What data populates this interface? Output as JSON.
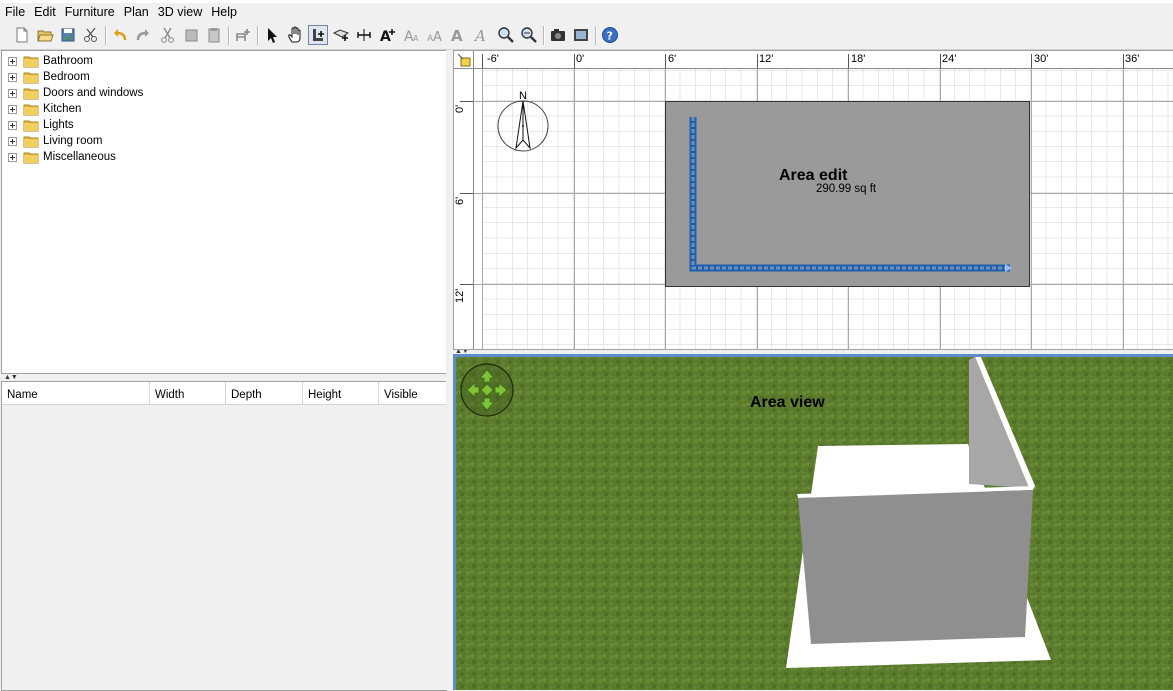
{
  "menu": [
    "File",
    "Edit",
    "Furniture",
    "Plan",
    "3D view",
    "Help"
  ],
  "toolbar_icons": [
    "new-home-icon",
    "open-icon",
    "save-icon",
    "cut-preferences-icon",
    "undo-icon",
    "redo-icon",
    "cut-icon",
    "copy-icon",
    "paste-icon",
    "add-furniture-icon",
    "select-icon",
    "pan-icon",
    "create-walls-icon",
    "create-rooms-icon",
    "create-dimensions-icon",
    "add-text-icon",
    "increase-text-icon",
    "decrease-text-icon",
    "bold-text-icon",
    "italic-text-icon",
    "zoom-in-icon",
    "zoom-out-icon",
    "create-photo-icon",
    "create-video-icon",
    "help-icon"
  ],
  "catalog": {
    "categories": [
      "Bathroom",
      "Bedroom",
      "Doors and windows",
      "Kitchen",
      "Lights",
      "Living room",
      "Miscellaneous"
    ]
  },
  "furniture_table": {
    "columns": [
      "Name",
      "Width",
      "Depth",
      "Height",
      "Visible"
    ]
  },
  "plan": {
    "ruler_x": [
      "-6'",
      "0'",
      "6'",
      "12'",
      "18'",
      "24'",
      "30'",
      "36'"
    ],
    "ruler_y": [
      "0'",
      "6'",
      "12'"
    ],
    "compass_label": "N",
    "room_label": "Area edit",
    "room_area": "290.99 sq ft"
  },
  "view3d": {
    "label": "Area view"
  },
  "colors": {
    "room_fill": "#9a9a9a",
    "wall_selected": "#1f5fae",
    "grass": "#5a7a2c",
    "selection_border": "#5e8cc9",
    "nav_arrow": "#7ec33a"
  }
}
